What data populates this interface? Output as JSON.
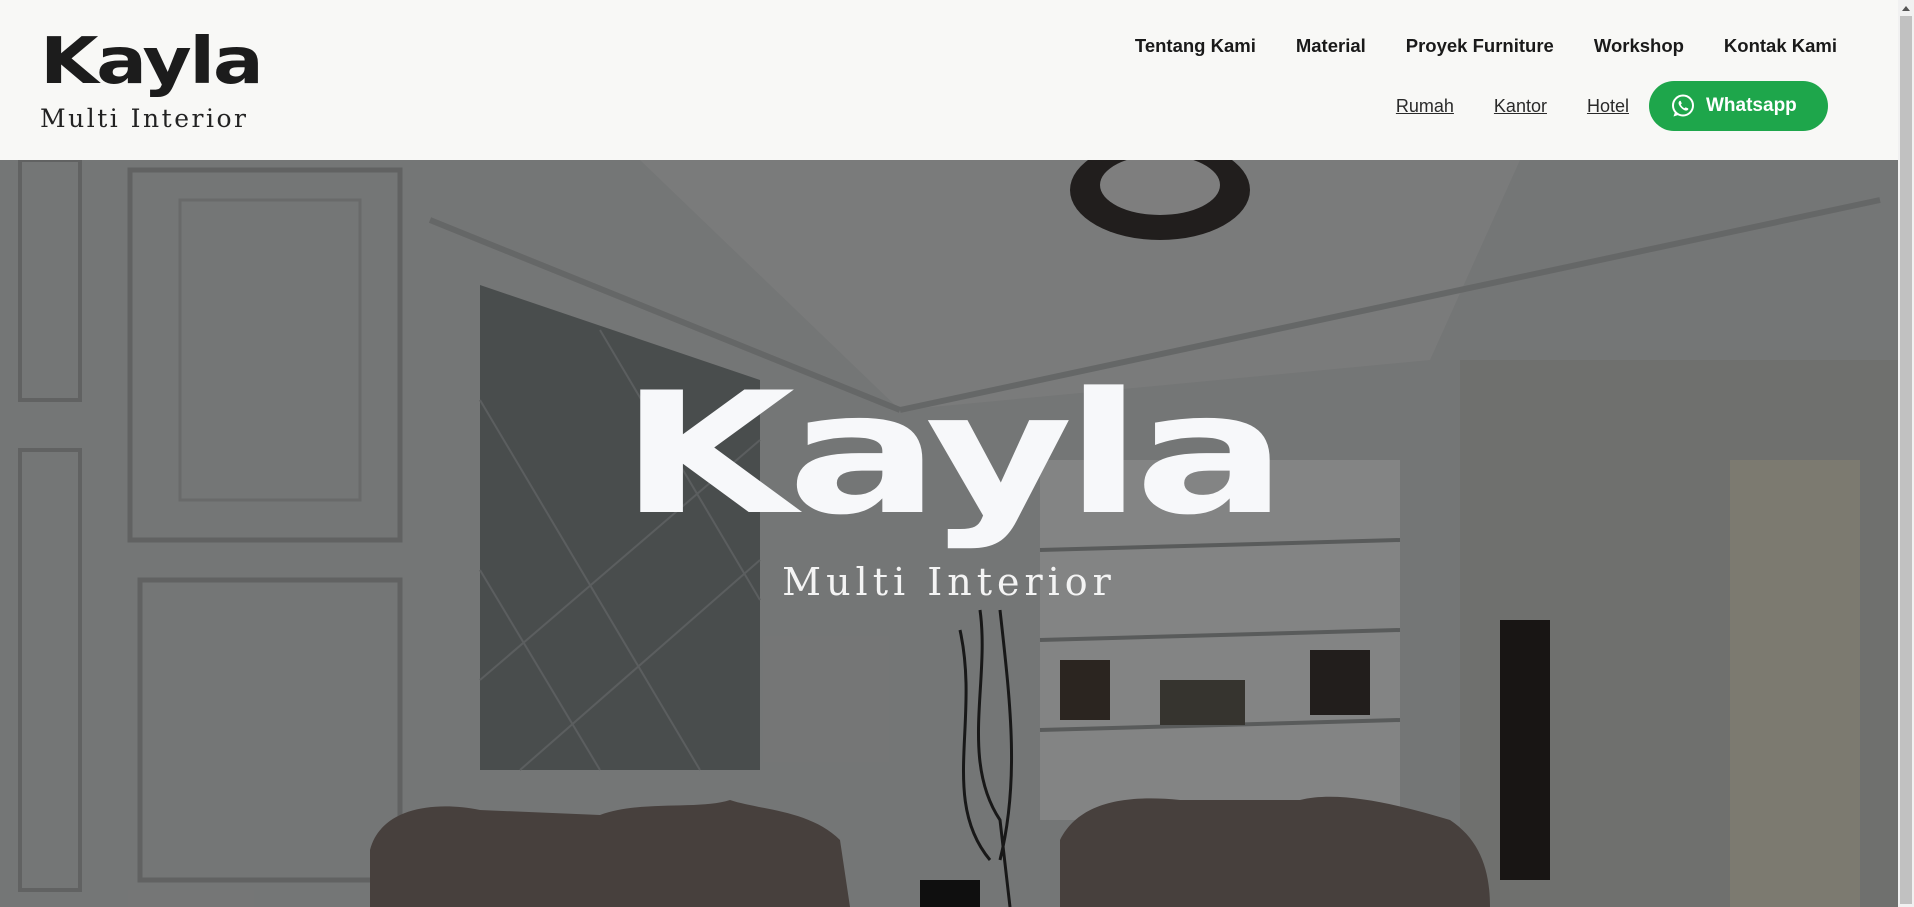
{
  "brand": {
    "name": "Kayla",
    "tagline": "Multi Interior"
  },
  "nav": {
    "primary": [
      {
        "label": "Tentang Kami"
      },
      {
        "label": "Material"
      },
      {
        "label": "Proyek Furniture"
      },
      {
        "label": "Workshop"
      },
      {
        "label": "Kontak Kami"
      }
    ],
    "secondary": [
      {
        "label": "Rumah"
      },
      {
        "label": "Kantor"
      },
      {
        "label": "Hotel"
      }
    ],
    "whatsapp": {
      "label": "Whatsapp",
      "icon": "whatsapp-icon"
    }
  },
  "hero": {
    "title": "Kayla",
    "subtitle": "Multi Interior",
    "background_image": "classic-living-room-interior"
  },
  "colors": {
    "header_bg": "#f8f8f6",
    "whatsapp_green": "#1ea64b",
    "logo_dark": "#1c1c1c",
    "hero_text": "#f7f8fa"
  }
}
